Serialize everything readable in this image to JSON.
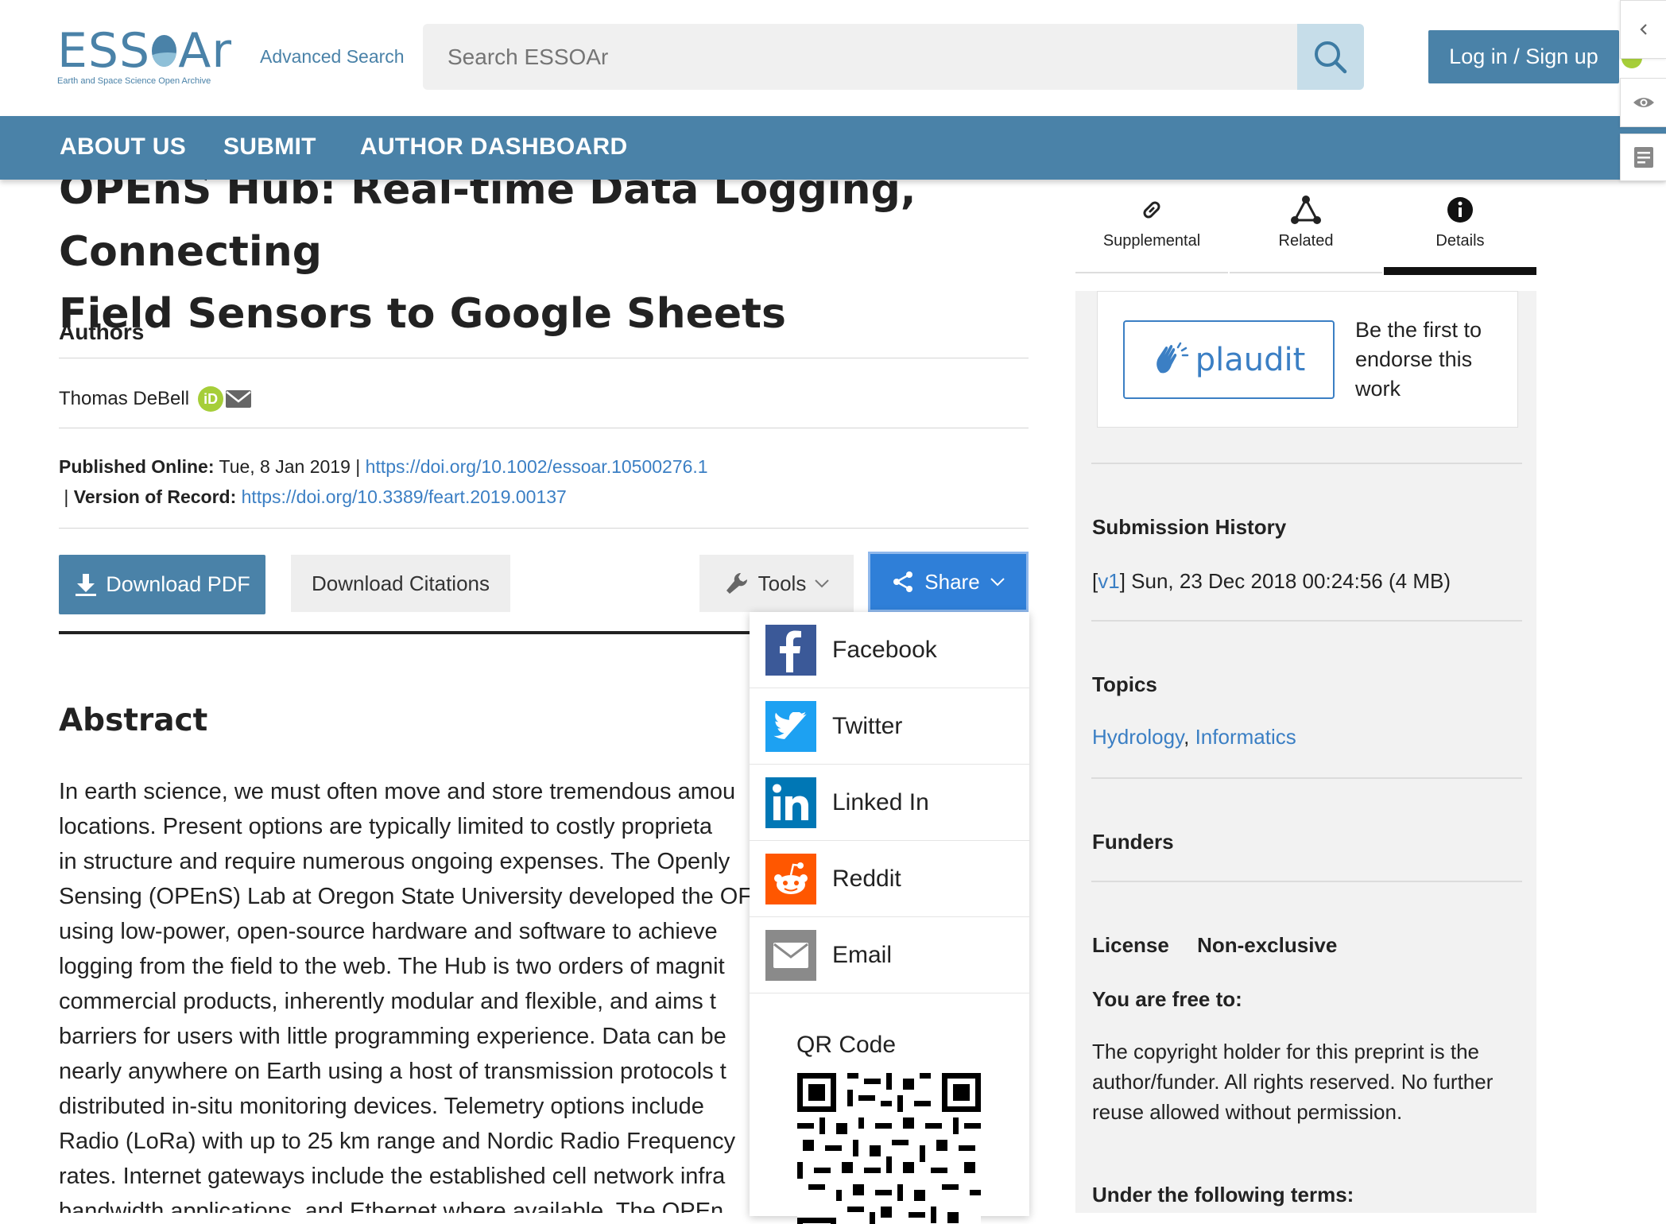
{
  "header": {
    "logo_text_left": "ESS",
    "logo_text_right": "Ar",
    "logo_sub": "Earth and Space Science Open Archive",
    "advanced_search": "Advanced Search",
    "search_placeholder": "Search ESSOAr",
    "login_label": "Log in / Sign up"
  },
  "nav": {
    "items": [
      "ABOUT US",
      "SUBMIT",
      "AUTHOR DASHBOARD"
    ]
  },
  "article": {
    "title_line1": "OPEnS Hub: Real-time Data Logging, Connecting",
    "title_line2": "Field Sensors to Google Sheets",
    "authors_heading": "Authors",
    "author_name": "Thomas DeBell",
    "orcid_label": "iD",
    "published_label": "Published Online:",
    "published_date": "Tue, 8 Jan 2019",
    "doi": "https://doi.org/10.1002/essoar.10500276.1",
    "version_label": "Version of Record:",
    "version_doi": "https://doi.org/10.3389/feart.2019.00137",
    "download_pdf": "Download PDF",
    "download_citations": "Download Citations",
    "tools": "Tools",
    "share": "Share",
    "abstract_heading": "Abstract",
    "abstract_lines": [
      "In earth science, we must often move and store tremendous amou",
      "locations. Present options are typically limited to costly proprieta",
      "in structure and require numerous ongoing expenses. The Openly",
      "Sensing (OPEnS) Lab at Oregon State University developed the OF",
      "using low-power, open-source hardware and software to achieve",
      "logging from the field to the web. The Hub is two orders of magnit",
      "commercial products, inherently modular and flexible, and aims t",
      "barriers for users with little programming experience. Data can be",
      "nearly anywhere on Earth using a host of transmission protocols t",
      "distributed in-situ monitoring devices. Telemetry options include",
      "Radio (LoRa) with up to 25 km range and Nordic Radio Frequency",
      "rates. Internet gateways include the established cell network infra",
      "bandwidth applications, and Ethernet where available. The OPEn"
    ]
  },
  "share_menu": {
    "items": [
      {
        "label": "Facebook",
        "icon": "facebook-icon",
        "color": "#3b5998"
      },
      {
        "label": "Twitter",
        "icon": "twitter-icon",
        "color": "#1da1f2"
      },
      {
        "label": "Linked In",
        "icon": "linkedin-icon",
        "color": "#0077b5"
      },
      {
        "label": "Reddit",
        "icon": "reddit-icon",
        "color": "#ff4500"
      },
      {
        "label": "Email",
        "icon": "email-icon",
        "color": "#888888"
      }
    ],
    "qr_label": "QR Code"
  },
  "sidebar": {
    "tabs": [
      {
        "label": "Supplemental",
        "icon": "link-icon"
      },
      {
        "label": "Related",
        "icon": "network-icon"
      },
      {
        "label": "Details",
        "icon": "info-icon",
        "active": true
      }
    ],
    "plaudit_word": "plaudit",
    "endorse_text": "Be the first to endorse this work",
    "submission_history_heading": "Submission History",
    "version_tag": "v1",
    "submission_entry": "Sun, 23 Dec 2018 00:24:56 (4 MB)",
    "topics_heading": "Topics",
    "topics": [
      "Hydrology",
      "Informatics"
    ],
    "funders_heading": "Funders",
    "license_heading": "License",
    "license_value": "Non-exclusive",
    "free_to_heading": "You are free to:",
    "license_text": "The copyright holder for this preprint is the author/funder. All rights reserved. No further reuse allowed without permission.",
    "terms_heading": "Under the following terms:"
  },
  "colors": {
    "brand": "#4a82a8",
    "link": "#3b7fc4",
    "share_button": "#2f7fd8",
    "orcid": "#a6ce39"
  }
}
